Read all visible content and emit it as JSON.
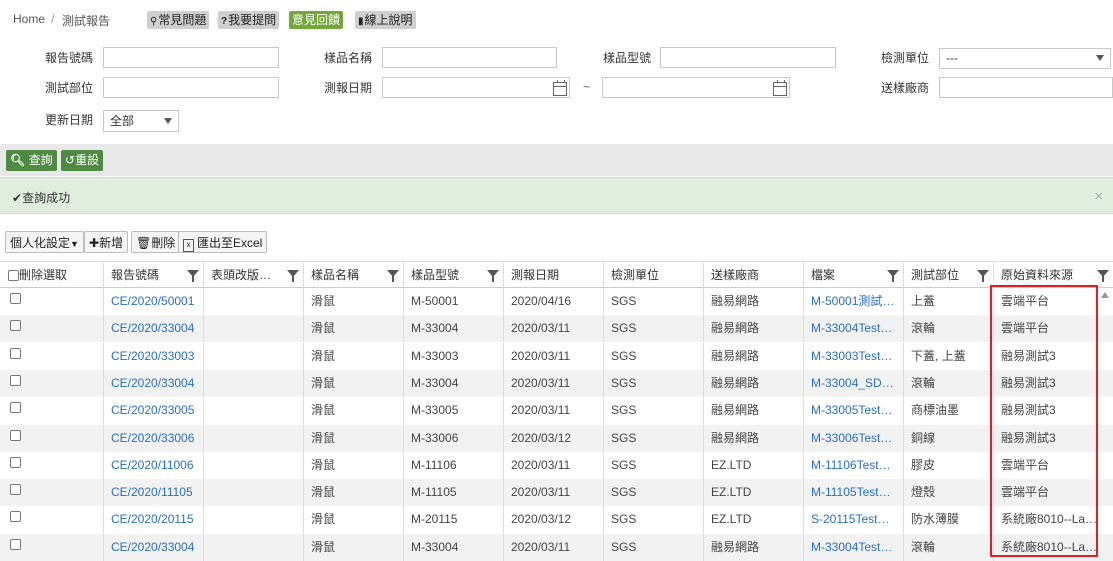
{
  "breadcrumb": {
    "home": "Home",
    "current": "測試報告",
    "separator": "/"
  },
  "top_buttons": [
    {
      "icon": "map-marker-icon",
      "label": "常見問題"
    },
    {
      "icon": "question-icon",
      "label": "我要提問"
    },
    {
      "icon": "",
      "label": "意見回饋"
    },
    {
      "icon": "book-icon",
      "label": "線上說明"
    }
  ],
  "filters": {
    "report_no": {
      "label": "報告號碼",
      "value": ""
    },
    "sample_name": {
      "label": "樣品名稱",
      "value": ""
    },
    "sample_model": {
      "label": "樣品型號",
      "value": ""
    },
    "test_unit": {
      "label": "檢測單位",
      "value": "---"
    },
    "test_part": {
      "label": "測試部位",
      "value": ""
    },
    "report_date": {
      "label": "測報日期",
      "from": "",
      "to": "",
      "range_sep": "~"
    },
    "vendor": {
      "label": "送樣廠商",
      "value": ""
    },
    "update_date": {
      "label": "更新日期",
      "value": "全部"
    }
  },
  "actions": {
    "query": "查詢",
    "reset": "重設"
  },
  "alert": {
    "message": "查詢成功",
    "close": "×"
  },
  "toolbar": {
    "personalize": "個人化設定",
    "add": "新增",
    "delete": "刪除",
    "export": "匯出至Excel"
  },
  "columns": [
    "刪除選取",
    "報告號碼",
    "表頭改版…",
    "樣品名稱",
    "樣品型號",
    "測報日期",
    "檢測單位",
    "送樣廠商",
    "檔案",
    "測試部位",
    "原始資料來源"
  ],
  "rows": [
    {
      "report_no": "CE/2020/50001",
      "header_rev": "",
      "sample_name": "滑鼠",
      "model": "M-50001",
      "date": "2020/04/16",
      "unit": "SGS",
      "vendor": "融易網路",
      "file": "M-50001測試…",
      "part": "上蓋",
      "source": "雲端平台"
    },
    {
      "report_no": "CE/2020/33004",
      "header_rev": "",
      "sample_name": "滑鼠",
      "model": "M-33004",
      "date": "2020/03/11",
      "unit": "SGS",
      "vendor": "融易網路",
      "file": "M-33004Test…",
      "part": "滾輪",
      "source": "雲端平台"
    },
    {
      "report_no": "CE/2020/33003",
      "header_rev": "",
      "sample_name": "滑鼠",
      "model": "M-33003",
      "date": "2020/03/11",
      "unit": "SGS",
      "vendor": "融易網路",
      "file": "M-33003Test…",
      "part": "下蓋, 上蓋",
      "source": "融易測試3"
    },
    {
      "report_no": "CE/2020/33004",
      "header_rev": "",
      "sample_name": "滑鼠",
      "model": "M-33004",
      "date": "2020/03/11",
      "unit": "SGS",
      "vendor": "融易網路",
      "file": "M-33004_SD…",
      "part": "滾輪",
      "source": "融易測試3"
    },
    {
      "report_no": "CE/2020/33005",
      "header_rev": "",
      "sample_name": "滑鼠",
      "model": "M-33005",
      "date": "2020/03/11",
      "unit": "SGS",
      "vendor": "融易網路",
      "file": "M-33005Test…",
      "part": "商標油墨",
      "source": "融易測試3"
    },
    {
      "report_no": "CE/2020/33006",
      "header_rev": "",
      "sample_name": "滑鼠",
      "model": "M-33006",
      "date": "2020/03/12",
      "unit": "SGS",
      "vendor": "融易網路",
      "file": "M-33006Test…",
      "part": "銅線",
      "source": "融易測試3"
    },
    {
      "report_no": "CE/2020/11006",
      "header_rev": "",
      "sample_name": "滑鼠",
      "model": "M-11106",
      "date": "2020/03/11",
      "unit": "SGS",
      "vendor": "EZ.LTD",
      "file": "M-11106Test…",
      "part": "膠皮",
      "source": "雲端平台"
    },
    {
      "report_no": "CE/2020/11105",
      "header_rev": "",
      "sample_name": "滑鼠",
      "model": "M-11105",
      "date": "2020/03/11",
      "unit": "SGS",
      "vendor": "EZ.LTD",
      "file": "M-11105Test…",
      "part": "燈殼",
      "source": "雲端平台"
    },
    {
      "report_no": "CE/2020/20115",
      "header_rev": "",
      "sample_name": "滑鼠",
      "model": "M-20115",
      "date": "2020/03/12",
      "unit": "SGS",
      "vendor": "EZ.LTD",
      "file": "S-20115Test…",
      "part": "防水薄膜",
      "source": "系統廠8010--La…"
    },
    {
      "report_no": "CE/2020/33004",
      "header_rev": "",
      "sample_name": "滑鼠",
      "model": "M-33004",
      "date": "2020/03/11",
      "unit": "SGS",
      "vendor": "融易網路",
      "file": "M-33004Test…",
      "part": "滾輪",
      "source": "系統廠8010--La…"
    }
  ],
  "colors": {
    "green_button": "#4e8a3f",
    "feedback_button": "#74a63a",
    "link": "#2a6ebb",
    "alert_bg": "#dfeedd",
    "highlight": "#e02020"
  }
}
